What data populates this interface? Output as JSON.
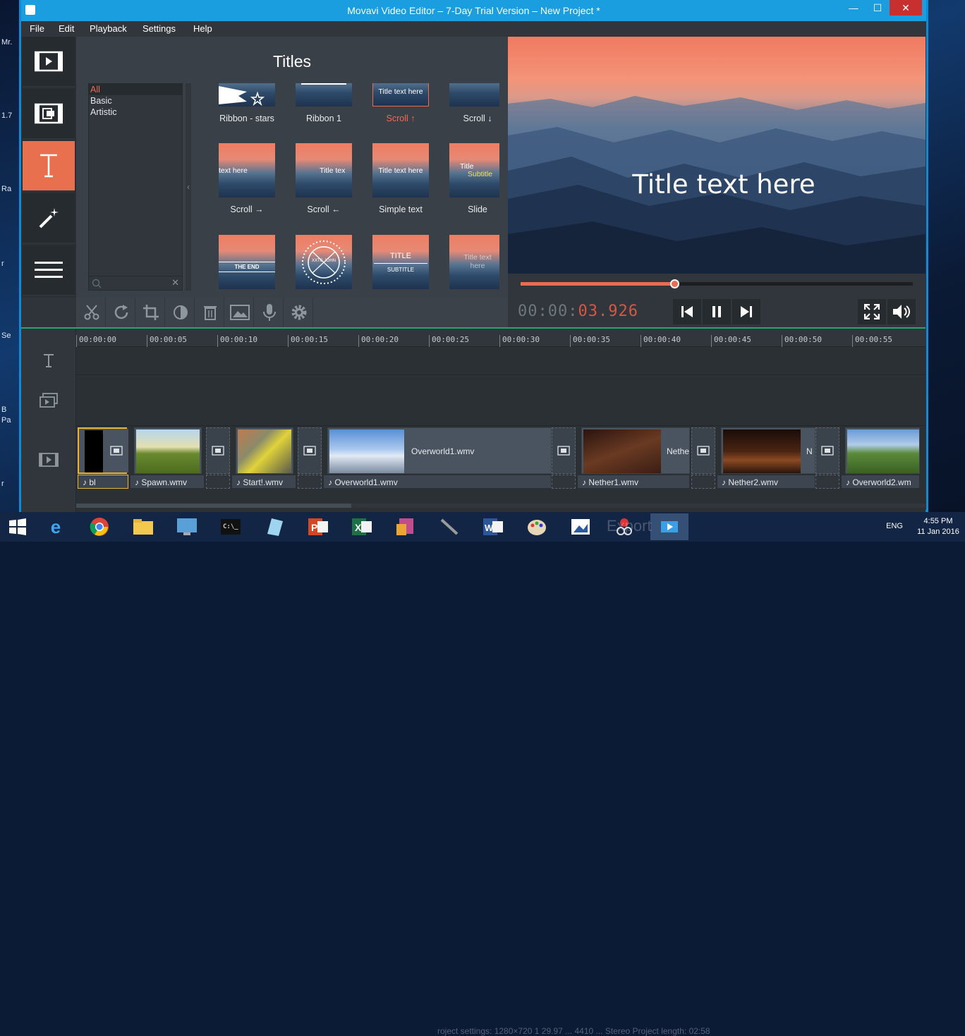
{
  "window": {
    "title": "Movavi Video Editor – 7-Day Trial Version – New Project *"
  },
  "window_controls": {
    "minimize": "—",
    "maximize": "☐",
    "close": "✕"
  },
  "desktop_labels": [
    "Mr.",
    "1.7",
    "Ra",
    "r",
    "Se",
    "B",
    "Pa",
    "r"
  ],
  "menu": [
    "File",
    "Edit",
    "Playback",
    "Settings",
    "Help"
  ],
  "sidebar": {
    "items": [
      {
        "name": "import",
        "icon": "film-play-icon"
      },
      {
        "name": "filters",
        "icon": "film-transition-icon"
      },
      {
        "name": "titles",
        "icon": "title-t-icon",
        "active": true
      },
      {
        "name": "effects",
        "icon": "magic-wand-icon"
      },
      {
        "name": "more",
        "icon": "hamburger-menu-icon"
      }
    ]
  },
  "titles_panel": {
    "heading": "Titles",
    "categories": [
      {
        "label": "All",
        "selected": true
      },
      {
        "label": "Basic"
      },
      {
        "label": "Artistic"
      }
    ],
    "collapse_glyph": "‹",
    "search_clear": "✕",
    "thumbnails": [
      {
        "label": "Ribbon - stars",
        "overlay": ""
      },
      {
        "label": "Ribbon 1",
        "overlay": ""
      },
      {
        "label": "Scroll ↑",
        "overlay": "Title text here",
        "highlight": true
      },
      {
        "label": "Scroll ↓",
        "overlay": ""
      },
      {
        "label": "Scroll →",
        "overlay": "text here"
      },
      {
        "label": "Scroll ←",
        "overlay": "Title tex"
      },
      {
        "label": "Simple text",
        "overlay": "Title text here"
      },
      {
        "label": "Slide",
        "overlay": "Title",
        "overlay2": "Subtitle"
      },
      {
        "label": "",
        "overlay": "THE END"
      },
      {
        "label": "",
        "overlay": "XXTC JOHN"
      },
      {
        "label": "",
        "overlay": "TITLE",
        "overlay2": "SUBTITLE"
      },
      {
        "label": "",
        "overlay": "Title text here"
      }
    ]
  },
  "tools": [
    "scissors-icon",
    "rotate-icon",
    "crop-icon",
    "color-adjust-icon",
    "delete-icon",
    "image-icon",
    "microphone-icon",
    "settings-gear-icon"
  ],
  "preview": {
    "title_text": "Title text here",
    "scrub_progress": 0.392,
    "timecode_dim": "00:00:",
    "timecode_lit": "03.926"
  },
  "transport": [
    "skip-back-icon",
    "pause-icon",
    "skip-forward-icon",
    "fullscreen-icon",
    "volume-icon"
  ],
  "timeline": {
    "ruler": [
      "00:00:00",
      "00:00:05",
      "00:00:10",
      "00:00:15",
      "00:00:20",
      "00:00:25",
      "00:00:30",
      "00:00:35",
      "00:00:40",
      "00:00:45",
      "00:00:50",
      "00:00:55"
    ],
    "clips": [
      {
        "name": "",
        "audio": "bl"
      },
      {
        "name": "",
        "audio": "Spawn.wmv"
      },
      {
        "name": "",
        "audio": "Start!.wmv"
      },
      {
        "name": "Overworld1.wmv",
        "audio": "Overworld1.wmv"
      },
      {
        "name": "Nethe",
        "audio": "Nether1.wmv"
      },
      {
        "name": "N",
        "audio": "Nether2.wmv"
      },
      {
        "name": "",
        "audio": "Overworld2.wm"
      }
    ]
  },
  "taskbar": {
    "apps": [
      "start-icon",
      "internet-explorer-icon",
      "chrome-icon",
      "file-explorer-icon",
      "control-panel-icon",
      "command-prompt-icon",
      "notes-icon",
      "powerpoint-icon",
      "excel-icon",
      "photo-app-icon",
      "tools-icon",
      "word-icon",
      "paint-icon",
      "image-viewer-icon",
      "snip-icon",
      "movavi-icon"
    ],
    "faint_status": "roject settings: 1280×720 1 29.97 ... 4410 ... Stereo   Project length: 02:58",
    "lang": "ENG",
    "time": "4:55 PM",
    "date": "11 Jan 2016",
    "export_ghost": "Export"
  }
}
